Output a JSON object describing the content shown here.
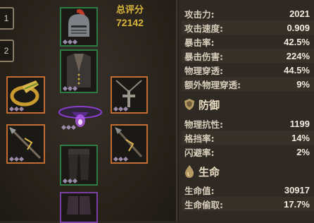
{
  "loadout_tabs": [
    "1",
    "2"
  ],
  "score": {
    "label": "总评分",
    "value": "72142"
  },
  "equipment_slots": [
    {
      "name": "helmet",
      "rarity": "green"
    },
    {
      "name": "chest-armor",
      "rarity": "green"
    },
    {
      "name": "ring",
      "rarity": "orange"
    },
    {
      "name": "amulet",
      "rarity": "orange"
    },
    {
      "name": "belt",
      "rarity": "purple"
    },
    {
      "name": "weapon-main",
      "rarity": "orange"
    },
    {
      "name": "weapon-off",
      "rarity": "orange"
    },
    {
      "name": "pants",
      "rarity": "green"
    },
    {
      "name": "boots",
      "rarity": "purple"
    }
  ],
  "attack_stats": [
    {
      "label": "攻击力:",
      "value": "2021"
    },
    {
      "label": "攻击速度:",
      "value": "0.909"
    },
    {
      "label": "暴击率:",
      "value": "42.5%"
    },
    {
      "label": "暴击伤害:",
      "value": "224%"
    },
    {
      "label": "物理穿透:",
      "value": "44.5%"
    },
    {
      "label": "额外物理穿透:",
      "value": "9%"
    }
  ],
  "defense": {
    "title": "防御",
    "icon": "shield-icon",
    "stats": [
      {
        "label": "物理抗性:",
        "value": "1199"
      },
      {
        "label": "格挡率:",
        "value": "14%"
      },
      {
        "label": "闪避率:",
        "value": "2%"
      }
    ]
  },
  "life": {
    "title": "生命",
    "icon": "blood-drop-icon",
    "stats": [
      {
        "label": "生命值:",
        "value": "30917"
      },
      {
        "label": "生命偷取:",
        "value": "17.7%"
      }
    ]
  }
}
